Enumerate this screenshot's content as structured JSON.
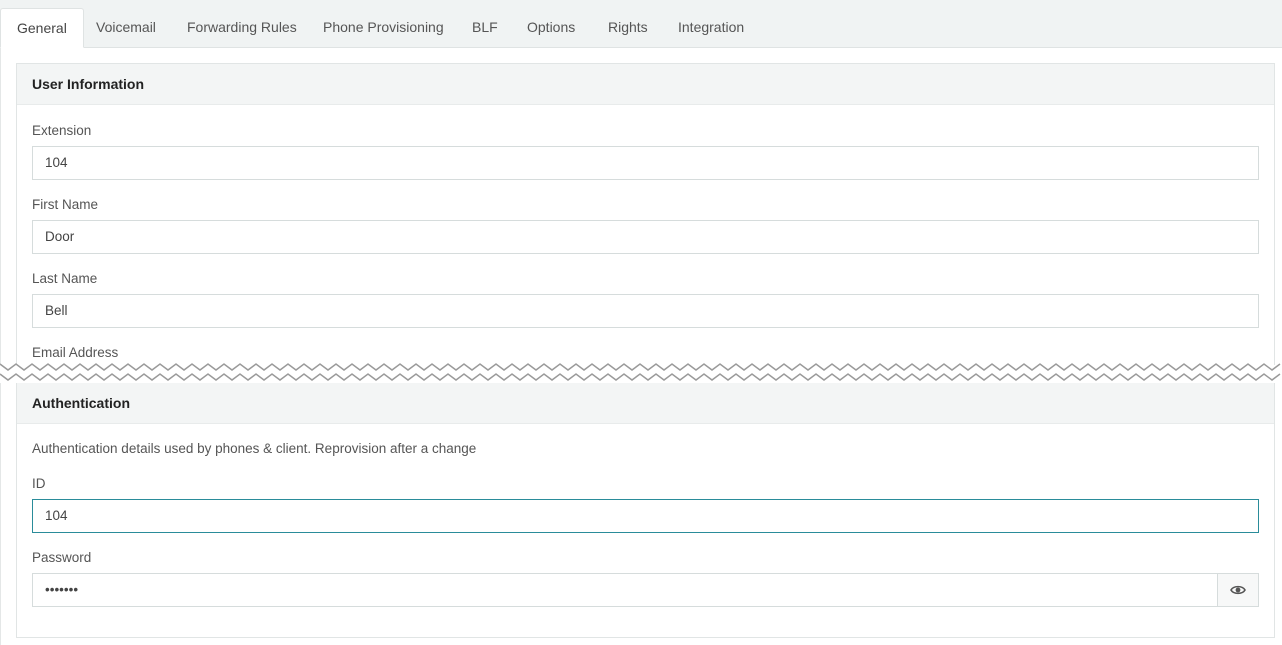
{
  "tabs": [
    {
      "label": "General",
      "active": true
    },
    {
      "label": "Voicemail"
    },
    {
      "label": "Forwarding Rules"
    },
    {
      "label": "Phone Provisioning"
    },
    {
      "label": "BLF"
    },
    {
      "label": "Options"
    },
    {
      "label": "Rights"
    },
    {
      "label": "Integration"
    }
  ],
  "user_info": {
    "title": "User Information",
    "extension_label": "Extension",
    "extension_value": "104",
    "first_name_label": "First Name",
    "first_name_value": "Door",
    "last_name_label": "Last Name",
    "last_name_value": "Bell",
    "email_label": "Email Address"
  },
  "auth": {
    "title": "Authentication",
    "help": "Authentication details used by phones & client. Reprovision after a change",
    "id_label": "ID",
    "id_value": "104",
    "password_label": "Password",
    "password_value": "•••••••",
    "toggle_icon": "eye-icon"
  },
  "colors": {
    "focus_border": "#2a8c9a",
    "tabbar_bg": "#f0f3f3"
  }
}
